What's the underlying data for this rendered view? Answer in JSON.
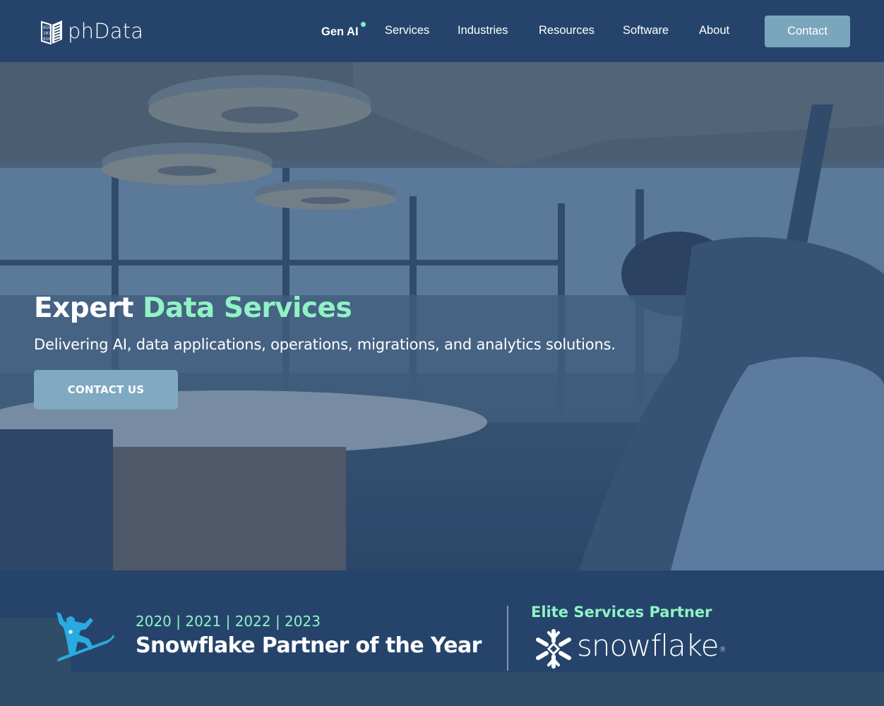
{
  "header": {
    "logo_text": "phData",
    "logo_icon": "binary-book-icon",
    "nav": [
      {
        "label": "Gen AI",
        "has_dot": true
      },
      {
        "label": "Services"
      },
      {
        "label": "Industries"
      },
      {
        "label": "Resources"
      },
      {
        "label": "Software"
      },
      {
        "label": "About"
      }
    ],
    "contact_label": "Contact"
  },
  "hero": {
    "title_plain": "Expert ",
    "title_accent": "Data Services",
    "subtitle": "Delivering AI, data applications, operations, migrations, and analytics solutions.",
    "cta_label": "CONTACT US",
    "background": "conference-room-photo"
  },
  "awards": {
    "years": "2020 | 2021 | 2022 | 2023",
    "title": "Snowflake Partner of the Year",
    "badge_icon": "snowboarder-icon",
    "partner_label": "Elite Services Partner",
    "partner_logo_text": "snowflake",
    "partner_logo_mark": "®"
  },
  "colors": {
    "header_bg": "#26446b",
    "accent_green": "#8ff3c4",
    "button_blue": "#7aa6bd",
    "snowboarder_blue": "#29aae1",
    "page_bg": "#2f4d66"
  }
}
